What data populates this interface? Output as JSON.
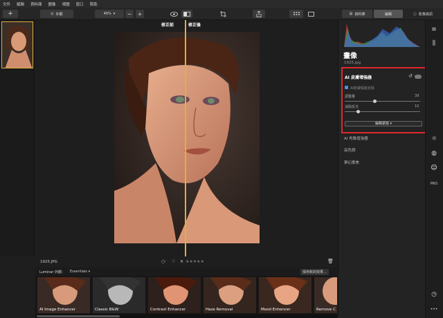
{
  "menubar": {
    "items": [
      "文件",
      "編輯",
      "資料庫",
      "圖像",
      "視圖",
      "窗口",
      "幫助"
    ]
  },
  "toolbar": {
    "add_label": "+",
    "looks_label": "外觀",
    "zoom_value": "46%",
    "zoom_out_label": "−",
    "zoom_in_label": "+",
    "library_tab": "資料庫",
    "edit_tab": "編輯",
    "info_tab": "影像資訊"
  },
  "canvas": {
    "before_label": "修正前",
    "after_label": "修正後"
  },
  "infobar": {
    "filename": "1925.JPG",
    "reject_label": "✕"
  },
  "lookbar": {
    "label": "Luminar 外觀：",
    "collection": "Essentials",
    "save_label": "保存新的效果..."
  },
  "looks": [
    {
      "name": "AI Image Enhancer"
    },
    {
      "name": "Classic B&W"
    },
    {
      "name": "Contrast Enhancer"
    },
    {
      "name": "Haze Removal"
    },
    {
      "name": "Mood Enhancer"
    },
    {
      "name": "Remove C"
    }
  ],
  "panel": {
    "section_title": "畫像",
    "filename": "1925.jpg",
    "enhancer": {
      "title": "AI 皮膚增強器",
      "checkbox_label": "AI皮膚瑕疵去除",
      "checkbox_checked": true,
      "slider1_label": "調整量",
      "slider1_value": "39",
      "slider2_label": "消除反光",
      "slider2_value": "10",
      "mask_button": "編輯蒙版 ▾"
    },
    "tools": [
      "AI 肖像增強器",
      "高色調",
      "夢幻柔焦"
    ]
  },
  "colors": {
    "accent": "#e0b040",
    "highlight_box": "#e0282d",
    "panel_bg": "#232323"
  }
}
